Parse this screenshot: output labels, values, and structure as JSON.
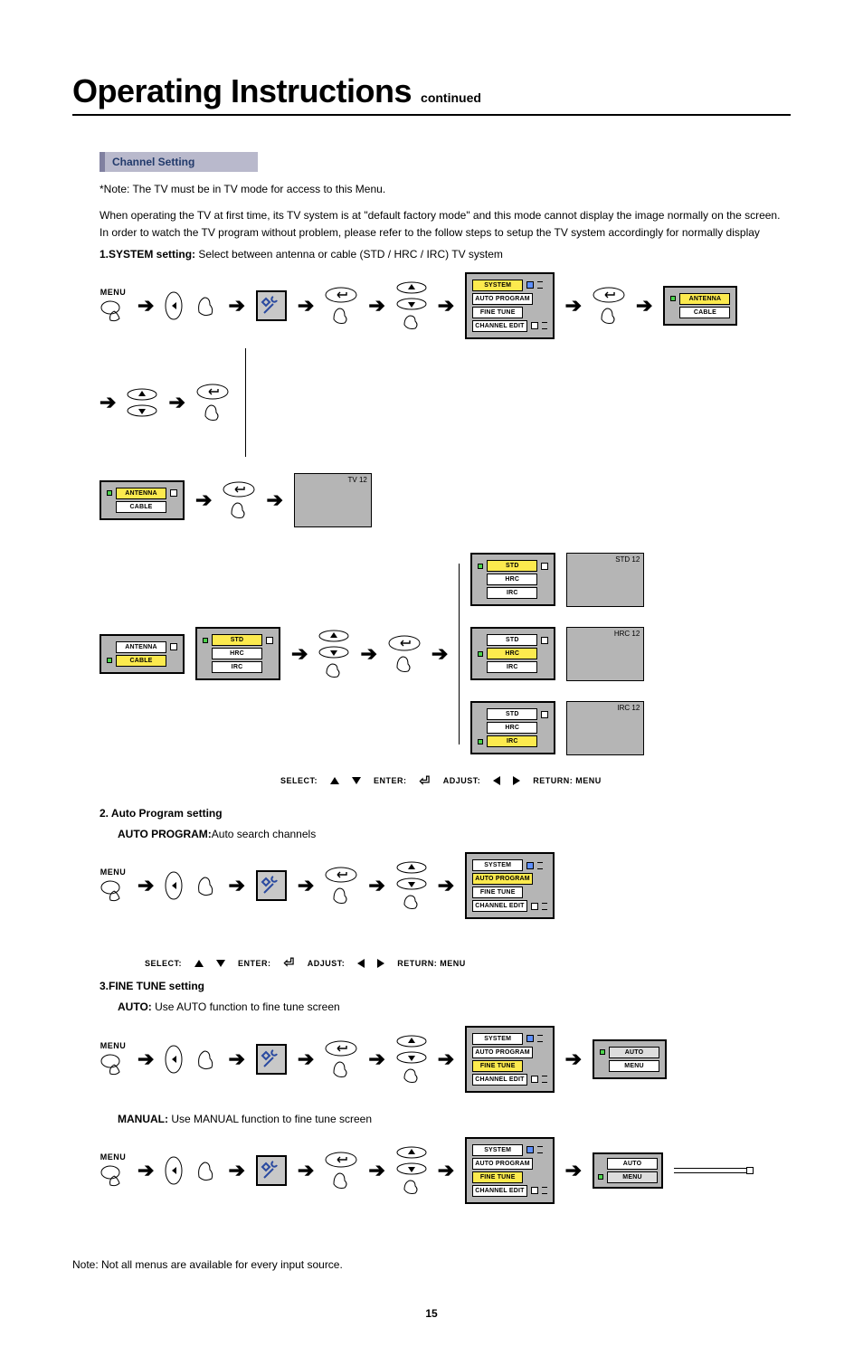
{
  "title": {
    "main": "Operating Instructions",
    "sub": "continued"
  },
  "section_chip": "Channel Setting",
  "note_line": "*Note: The TV must be in TV mode for access to this Menu.",
  "intro_para": "When operating the TV at first time, its TV system is at \"default factory mode\" and this mode cannot display the image normally on the screen. In order to watch the TV program without problem, please refer to the follow steps to setup the TV system accordingly for normally display",
  "step1_label": "1.SYSTEM setting:",
  "step1_desc": " Select between antenna or cable (STD / HRC / IRC) TV system",
  "osd": {
    "system": "SYSTEM",
    "auto_program": "AUTO PROGRAM",
    "fine_tune": "FINE TUNE",
    "channel_edit": "CHANNEL EDIT",
    "antenna": "ANTENNA",
    "cable": "CABLE",
    "std": "STD",
    "hrc": "HRC",
    "irc": "IRC",
    "auto": "AUTO",
    "menu": "MENU"
  },
  "tv12": "TV 12",
  "std12": "STD 12",
  "hrc12": "HRC 12",
  "irc12": "IRC 12",
  "menu_label": "MENU",
  "legend": {
    "select": "SELECT:",
    "enter": "ENTER:",
    "adjust": "ADJUST:",
    "ret": "RETURN: MENU"
  },
  "step2_heading": "2. Auto Program setting",
  "step2_bold": "AUTO PROGRAM:",
  "step2_desc": "Auto search channels",
  "step3_heading": "3.FINE TUNE setting",
  "step3a_bold": "AUTO:",
  "step3a_desc": " Use AUTO function to fine tune screen",
  "step3b_bold": "MANUAL:",
  "step3b_desc": " Use MANUAL function to fine tune screen",
  "footnote": "Note: Not all menus are available for every input source.",
  "page_number": "15"
}
